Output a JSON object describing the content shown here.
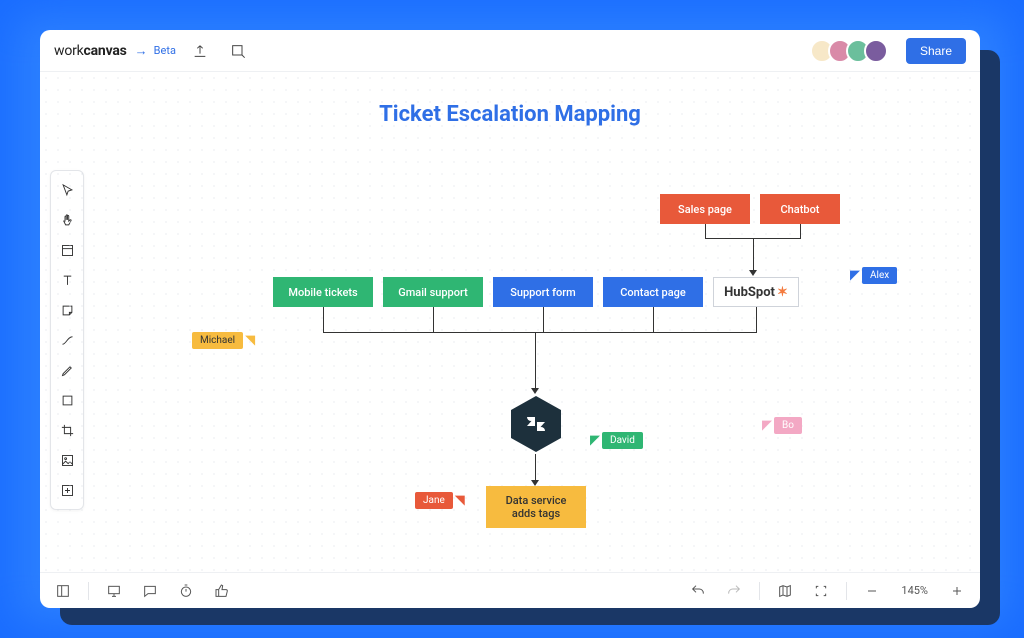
{
  "brand": {
    "part1": "work",
    "part2": "canvas",
    "arrow": "→",
    "beta": "Beta"
  },
  "header": {
    "share": "Share"
  },
  "avatars": [
    {
      "bg": "#f7e8c8"
    },
    {
      "bg": "#d98aa8"
    },
    {
      "bg": "#6bbf9c"
    },
    {
      "bg": "#7a5c9e"
    }
  ],
  "diagram": {
    "title": "Ticket Escalation Mapping",
    "nodes": {
      "sales": "Sales page",
      "chatbot": "Chatbot",
      "mobile": "Mobile tickets",
      "gmail": "Gmail support",
      "supportform": "Support form",
      "contact": "Contact page",
      "hubspot": "HubSpot",
      "tags": "Data service adds tags"
    }
  },
  "cursors": {
    "alex": "Alex",
    "michael": "Michael",
    "david": "David",
    "bo": "Bo",
    "jane": "Jane"
  },
  "zoom": "145%"
}
